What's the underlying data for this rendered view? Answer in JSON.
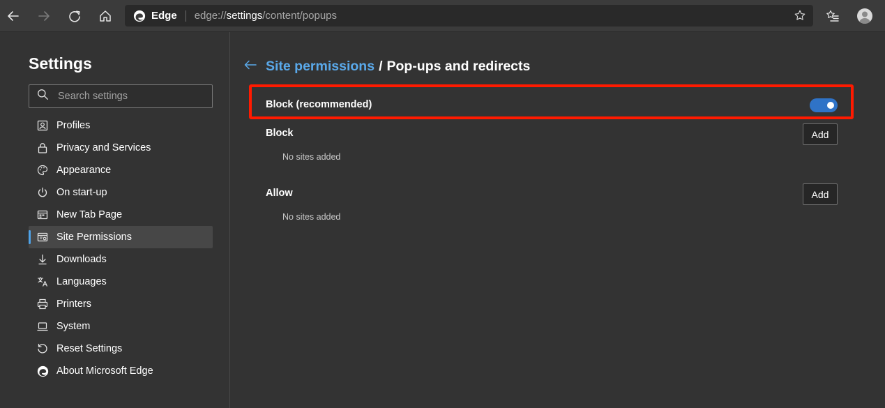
{
  "toolbar": {
    "back_icon": "arrow-left-icon",
    "forward_icon": "arrow-right-icon",
    "refresh_icon": "refresh-icon",
    "home_icon": "home-icon",
    "address": {
      "brand": "Edge",
      "url_scheme": "edge://",
      "url_host": "settings",
      "url_path": "/content/popups"
    },
    "favorite_icon": "star-outline-icon",
    "favorites_icon": "favorites-list-icon",
    "profile_icon": "profile-avatar-icon"
  },
  "sidebar": {
    "title": "Settings",
    "search_placeholder": "Search settings",
    "items": [
      {
        "label": "Profiles",
        "icon": "profile-card-icon",
        "active": false
      },
      {
        "label": "Privacy and Services",
        "icon": "lock-icon",
        "active": false
      },
      {
        "label": "Appearance",
        "icon": "palette-icon",
        "active": false
      },
      {
        "label": "On start-up",
        "icon": "power-icon",
        "active": false
      },
      {
        "label": "New Tab Page",
        "icon": "new-tab-icon",
        "active": false
      },
      {
        "label": "Site Permissions",
        "icon": "site-permissions-icon",
        "active": true
      },
      {
        "label": "Downloads",
        "icon": "download-icon",
        "active": false
      },
      {
        "label": "Languages",
        "icon": "languages-icon",
        "active": false
      },
      {
        "label": "Printers",
        "icon": "printer-icon",
        "active": false
      },
      {
        "label": "System",
        "icon": "laptop-icon",
        "active": false
      },
      {
        "label": "Reset Settings",
        "icon": "reset-icon",
        "active": false
      },
      {
        "label": "About Microsoft Edge",
        "icon": "edge-logo-icon",
        "active": false
      }
    ]
  },
  "main": {
    "breadcrumb": {
      "parent": "Site permissions",
      "separator": "/",
      "current": "Pop-ups and redirects"
    },
    "block_recommended": {
      "label": "Block (recommended)",
      "toggle_on": true
    },
    "block_section": {
      "title": "Block",
      "empty_text": "No sites added",
      "add_label": "Add"
    },
    "allow_section": {
      "title": "Allow",
      "empty_text": "No sites added",
      "add_label": "Add"
    }
  },
  "colors": {
    "accent": "#5aa9ea",
    "toggle": "#2f73c7",
    "highlight": "#ff1a00",
    "background": "#333333"
  }
}
